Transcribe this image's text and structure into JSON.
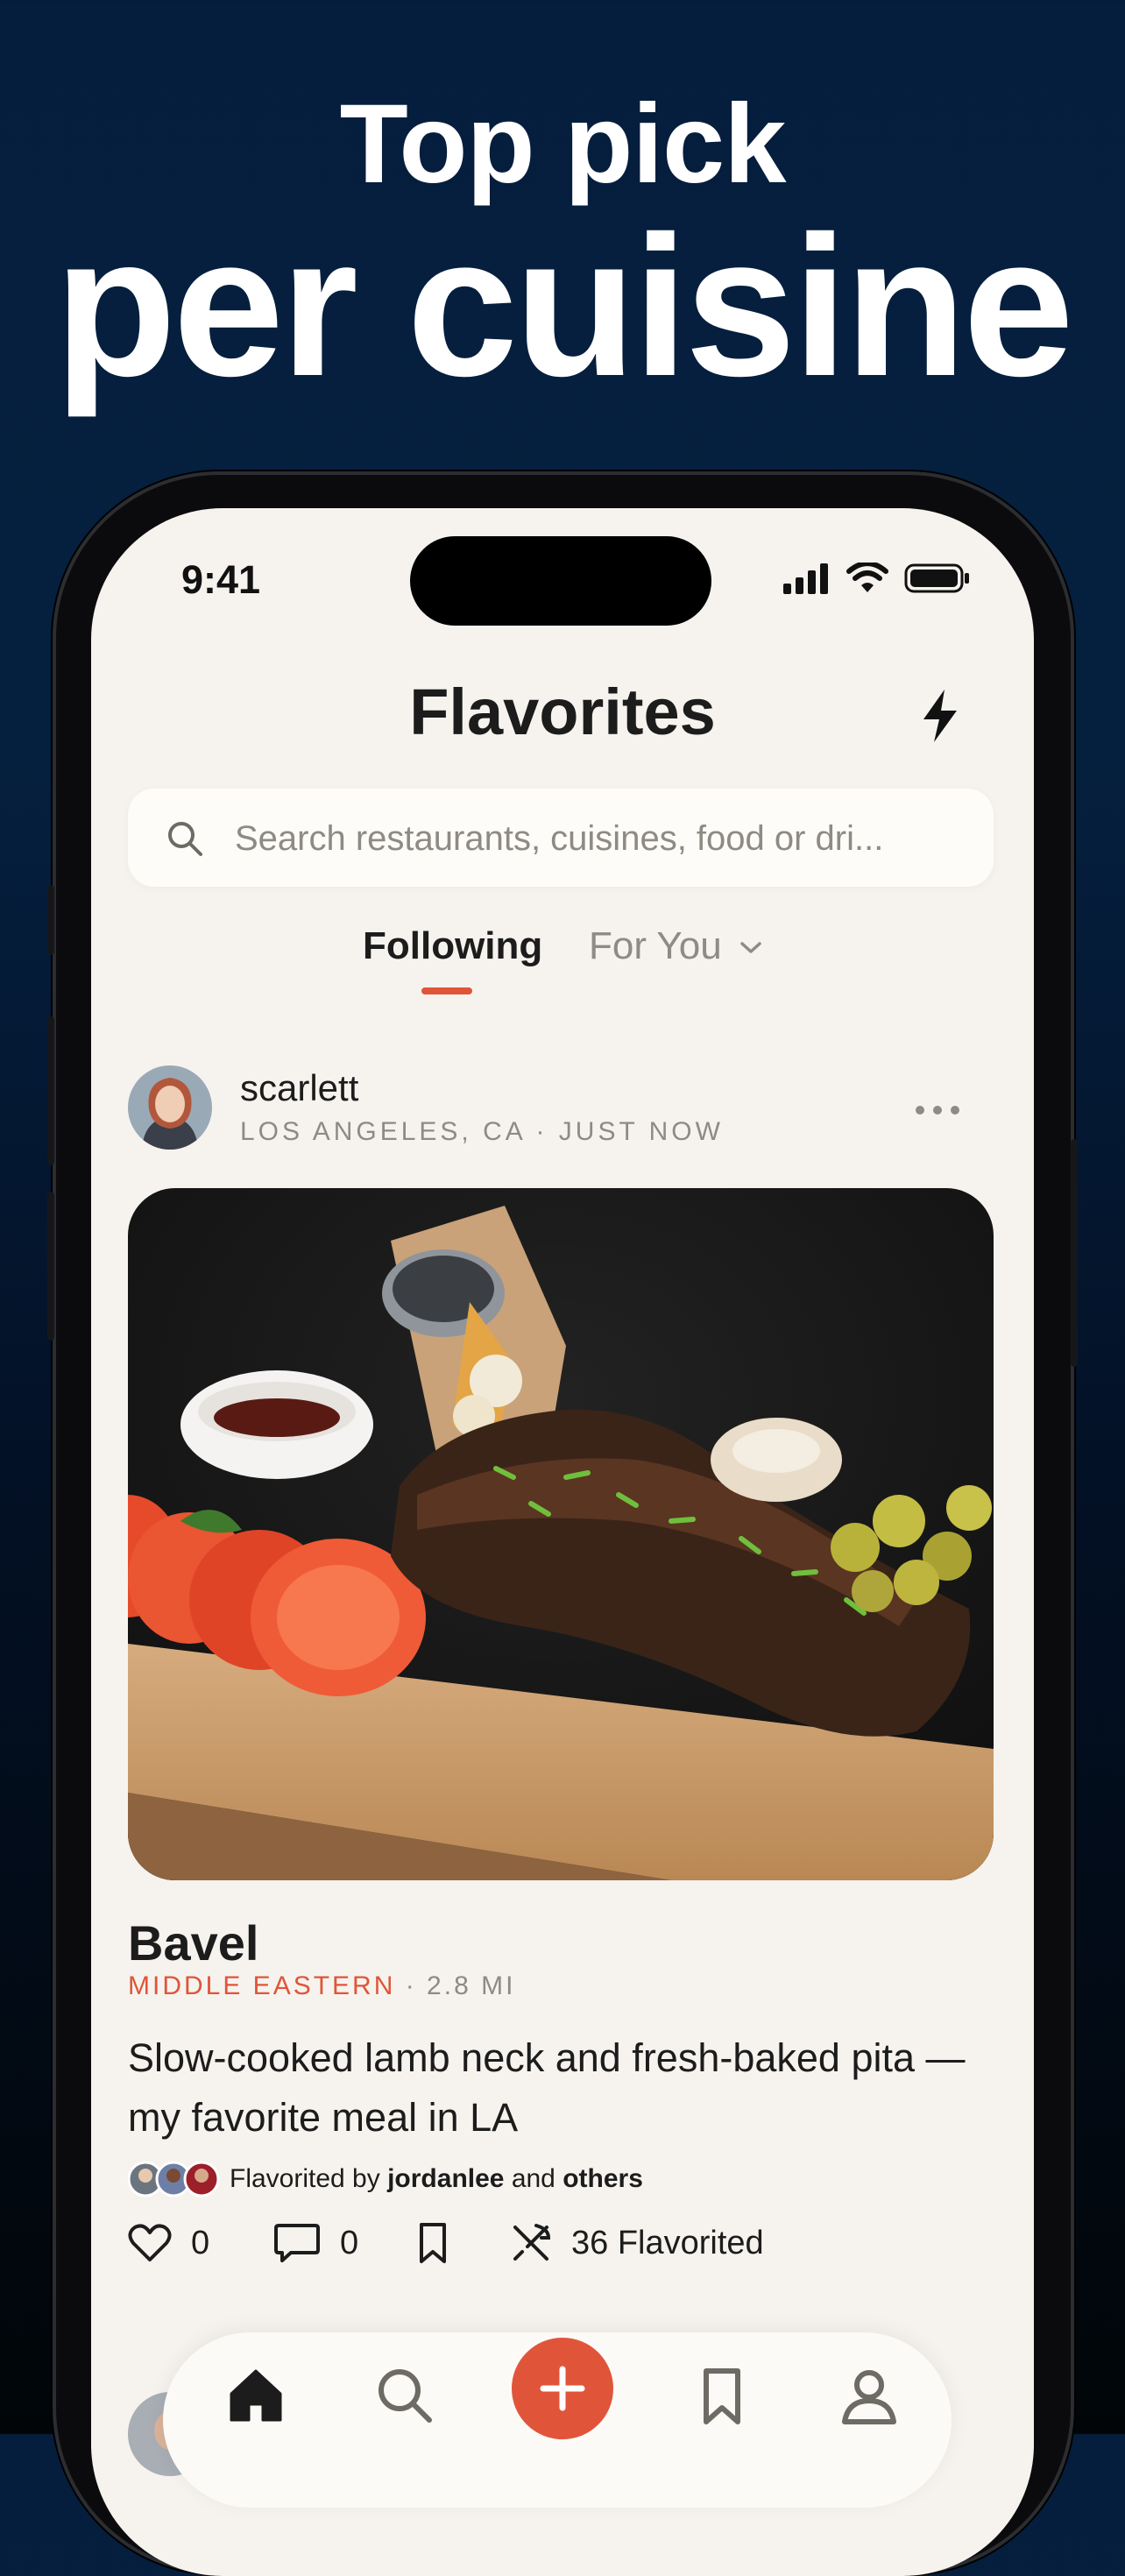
{
  "promo": {
    "line1": "Top pick",
    "line2": "per cuisine"
  },
  "status_bar": {
    "time": "9:41",
    "icons": [
      "signal-icon",
      "wifi-icon",
      "battery-icon"
    ]
  },
  "app": {
    "title": "Flavorites",
    "header_icon": "bolt-icon"
  },
  "search": {
    "placeholder": "Search restaurants, cuisines, food or dri..."
  },
  "tabs": [
    {
      "label": "Following",
      "active": true
    },
    {
      "label": "For You",
      "active": false,
      "icon": "chevron-down-icon"
    }
  ],
  "post": {
    "username": "scarlett",
    "location": "LOS ANGELES, CA · JUST NOW",
    "restaurant": "Bavel",
    "cuisine": "MIDDLE EASTERN",
    "distance": "· 2.8 MI",
    "description": "Slow-cooked lamb neck and fresh-baked pita — my favorite meal in LA",
    "favorited_prefix": "Flavorited by",
    "favorited_user": "jordanlee",
    "favorited_and": "and",
    "favorited_others": "others",
    "likes": "0",
    "comments": "0",
    "flavorited_count": "36 Flavorited"
  },
  "nav": {
    "items": [
      "home-icon",
      "search-icon",
      "add-icon",
      "bookmark-icon",
      "profile-icon"
    ]
  },
  "colors": {
    "accent": "#e0553a",
    "background": "#f6f3ee",
    "promo_bg": "#061e3d"
  }
}
